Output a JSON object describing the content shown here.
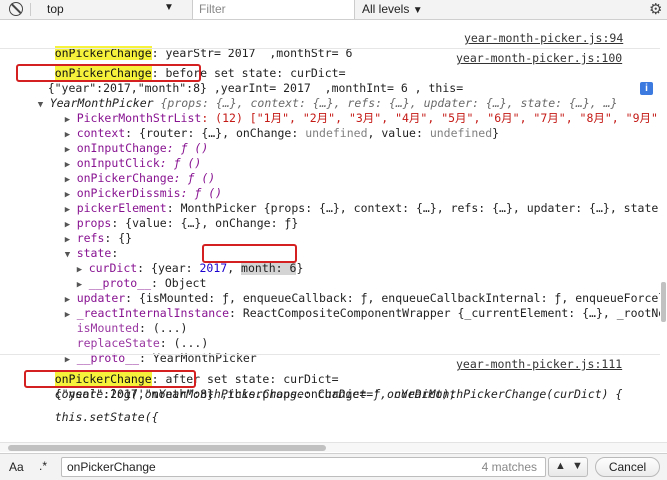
{
  "toolbar": {
    "context": "top",
    "filter_placeholder": "Filter",
    "levels": "All levels",
    "dropdown_glyph": "▼",
    "gear_glyph": "⚙"
  },
  "console": {
    "m1": {
      "keyword": "onPickerChange",
      "text": ": yearStr= 2017  ,monthStr= 6",
      "source": "year-month-picker.js:94"
    },
    "m2": {
      "keyword": "onPickerChange",
      "text": ": before set state: curDict=",
      "source": "year-month-picker.js:100",
      "json": "{\"year\":2017,\"month\":8}",
      "rest": " ,yearInt= 2017  ,monthInt= 6 , this="
    },
    "obj": {
      "name": "YearMonthPicker",
      "summary": " {props: {…}, context: {…}, refs: {…}, updater: {…}, state: {…}, …}",
      "info": "i",
      "l1_key": "PickerMonthStrList",
      "l1_val": ": (12) [\"1月\", \"2月\", \"3月\", \"4月\", \"5月\", \"6月\", \"7月\", \"8月\", \"9月\",",
      "l2_key": "context",
      "l2_val": ": {router: {…}, onChange: ",
      "l2_und": "undefined",
      "l2_val2": ", value: ",
      "l2_end": "}",
      "l3_key": "onInputChange",
      "l3_val": ": ƒ ()",
      "l4_key": "onInputClick",
      "l4_val": ": ƒ ()",
      "l5_key": "onPickerChange",
      "l5_val": ": ƒ ()",
      "l6_key": "onPickerDissmis",
      "l6_val": ": ƒ ()",
      "l7_key": "pickerElement",
      "l7_val": ": MonthPicker {props: {…}, context: {…}, refs: {…}, updater: {…}, state:",
      "l8_key": "props",
      "l8_val": ": {value: {…}, onChange: ƒ}",
      "l9_key": "refs",
      "l9_val": ": {}",
      "l10_key": "state",
      "l10_colon": ":",
      "l11_key": "curDict",
      "l11_val": ": {year: ",
      "l11_year": "2017",
      "l11_sep": ", ",
      "l11_month": "month: 6",
      "l11_end": "}",
      "l12_key": "__proto__",
      "l12_val": ": Object",
      "l13_key": "updater",
      "l13_val": ": {isMounted: ƒ, enqueueCallback: ƒ, enqueueCallbackInternal: ƒ, enqueueForcel",
      "l14_key": "_reactInternalInstance",
      "l14_val": ": ReactCompositeComponentWrapper {_currentElement: {…}, _rootNo",
      "l15_key": "isMounted",
      "l15_val": ": (...)",
      "l16_key": "replaceState",
      "l16_val": ": (...)",
      "l17_key": "__proto__",
      "l17_val": ": YearMonthPicker"
    },
    "m3": {
      "keyword": "onPickerChange",
      "text": ": after set state: curDict=",
      "source": "year-month-picker.js:111",
      "json": "{\"year\":2017,\"month\":8}",
      "rest": " ,this.props.onChange= ",
      "fn": "ƒ onYearMonthPickerChange(curDict) {",
      "code1": "    console.log('onYearMonthPickerChange: curDict=', curDict);",
      "code2": "    this.setState({"
    }
  },
  "search": {
    "aa": "Aa",
    "regex": ".*",
    "value": "onPickerChange",
    "count": "4 matches",
    "up_glyph": "▲",
    "down_glyph": "▼",
    "cancel": "Cancel"
  },
  "colors": {
    "highlight": "#f6f23c",
    "red_box": "#d42020",
    "number": "#1c00cf",
    "string": "#c41a16",
    "property": "#881391"
  }
}
